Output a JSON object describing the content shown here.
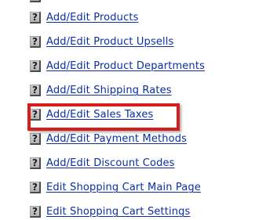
{
  "menu": {
    "items": [
      {
        "label": "Add/Edit Products",
        "icon": "help-icon",
        "icon_glyph": "?"
      },
      {
        "label": "Add/Edit Product Upsells",
        "icon": "help-icon",
        "icon_glyph": "?"
      },
      {
        "label": "Add/Edit Product Departments",
        "icon": "help-icon",
        "icon_glyph": "?"
      },
      {
        "label": "Add/Edit Shipping Rates",
        "icon": "help-icon",
        "icon_glyph": "?"
      },
      {
        "label": "Add/Edit Sales Taxes",
        "icon": "help-icon",
        "icon_glyph": "?",
        "highlighted": true
      },
      {
        "label": "Add/Edit Payment Methods",
        "icon": "help-icon",
        "icon_glyph": "?"
      },
      {
        "label": "Add/Edit Discount Codes",
        "icon": "help-icon",
        "icon_glyph": "?"
      },
      {
        "label": "Edit Shopping Cart Main Page",
        "icon": "help-icon",
        "icon_glyph": "?"
      },
      {
        "label": "Edit Shopping Cart Settings",
        "icon": "help-icon",
        "icon_glyph": "?"
      }
    ]
  },
  "colors": {
    "link": "#0a2fa6",
    "highlight": "#d91c1c",
    "background": "#ffffff"
  }
}
